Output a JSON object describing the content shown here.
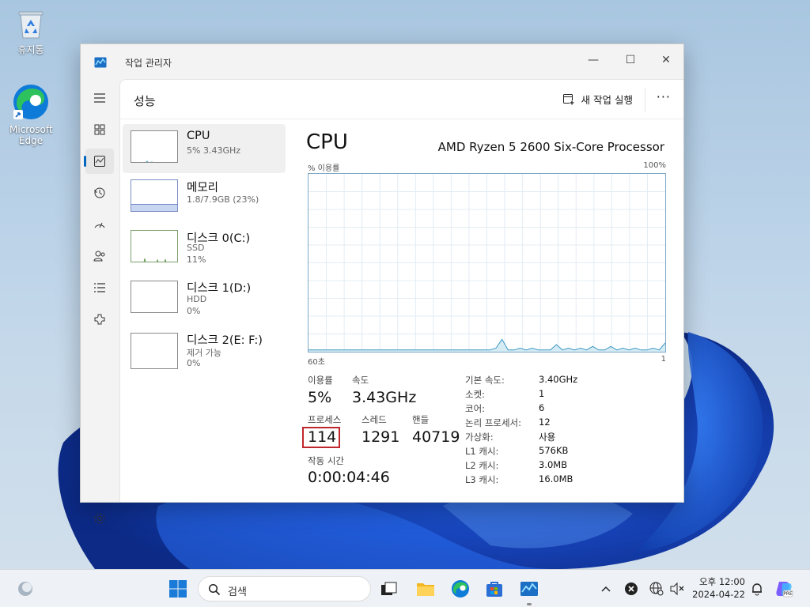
{
  "desktop": {
    "icons": [
      {
        "label": "휴지통",
        "icon": "recycle-bin-icon"
      },
      {
        "label": "Microsoft Edge",
        "icon": "edge-icon"
      }
    ]
  },
  "window": {
    "title": "작업 관리자",
    "controls": {
      "minimize": "—",
      "maximize": "☐",
      "close": "✕"
    }
  },
  "nav": {
    "items": [
      {
        "name": "hamburger-menu",
        "icon": "menu-icon"
      },
      {
        "name": "processes",
        "icon": "processes-icon"
      },
      {
        "name": "performance",
        "icon": "performance-icon",
        "active": true
      },
      {
        "name": "app-history",
        "icon": "history-icon"
      },
      {
        "name": "startup-apps",
        "icon": "startup-icon"
      },
      {
        "name": "users",
        "icon": "users-icon"
      },
      {
        "name": "details",
        "icon": "details-icon"
      },
      {
        "name": "services",
        "icon": "services-icon"
      },
      {
        "name": "settings",
        "icon": "gear-icon"
      }
    ]
  },
  "header": {
    "page_title": "성능",
    "run_new_task": "새 작업 실행",
    "more": "···"
  },
  "devices": [
    {
      "name": "CPU",
      "sub1": "5% 3.43GHz",
      "sub2": ""
    },
    {
      "name": "메모리",
      "sub1": "1.8/7.9GB (23%)",
      "sub2": ""
    },
    {
      "name": "디스크 0(C:)",
      "sub1": "SSD",
      "sub2": "11%"
    },
    {
      "name": "디스크 1(D:)",
      "sub1": "HDD",
      "sub2": "0%"
    },
    {
      "name": "디스크 2(E: F:)",
      "sub1": "제거 가능",
      "sub2": "0%"
    }
  ],
  "detail": {
    "title": "CPU",
    "model": "AMD Ryzen 5 2600 Six-Core Processor",
    "graph_label_left": "% 이용률",
    "graph_label_right": "100%",
    "graph_time_left": "60초",
    "graph_time_right": "1",
    "stats": {
      "utilization_label": "이용률",
      "utilization_value": "5%",
      "speed_label": "속도",
      "speed_value": "3.43GHz",
      "processes_label": "프로세스",
      "processes_value": "114",
      "threads_label": "스레드",
      "threads_value": "1291",
      "handles_label": "핸들",
      "handles_value": "40719",
      "uptime_label": "작동 시간",
      "uptime_value": "0:00:04:46"
    },
    "specs": [
      {
        "label": "기본 속도:",
        "value": "3.40GHz"
      },
      {
        "label": "소켓:",
        "value": "1"
      },
      {
        "label": "코어:",
        "value": "6"
      },
      {
        "label": "논리 프로세서:",
        "value": "12"
      },
      {
        "label": "가상화:",
        "value": "사용"
      },
      {
        "label": "L1 캐시:",
        "value": "576KB"
      },
      {
        "label": "L2 캐시:",
        "value": "3.0MB"
      },
      {
        "label": "L3 캐시:",
        "value": "16.0MB"
      }
    ]
  },
  "chart_data": {
    "type": "area",
    "ylim": [
      0,
      100
    ],
    "values": [
      1,
      1,
      1,
      1,
      1,
      1,
      1,
      1,
      1,
      1,
      1,
      1,
      1,
      1,
      1,
      1,
      1,
      1,
      1,
      1,
      1,
      1,
      1,
      1,
      1,
      1,
      1,
      1,
      1,
      1,
      1,
      2,
      7,
      1,
      1,
      2,
      1,
      2,
      1,
      1,
      1,
      4,
      1,
      2,
      1,
      2,
      1,
      3,
      1,
      1,
      3,
      1,
      2,
      1,
      2,
      1,
      1,
      2,
      1,
      5
    ]
  },
  "taskbar": {
    "search_placeholder": "검색",
    "time": "오후 12:00",
    "date": "2024-04-22",
    "accent": "#0067c0"
  }
}
